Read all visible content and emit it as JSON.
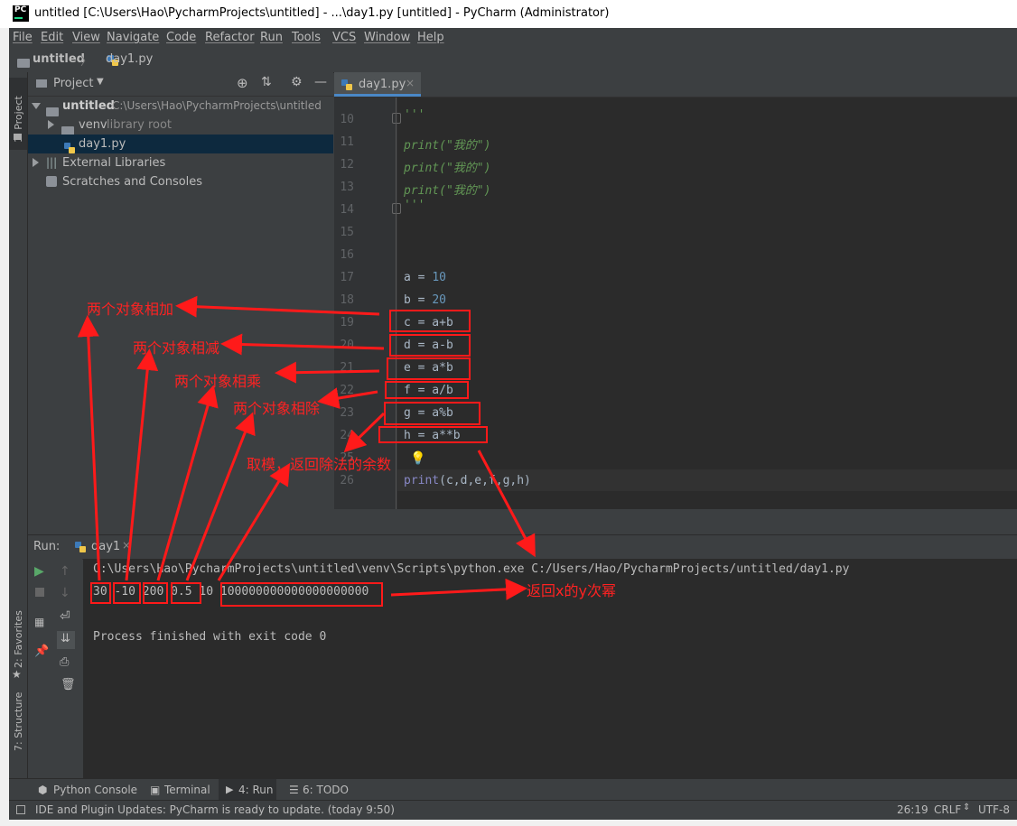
{
  "window": {
    "title": "untitled [C:\\Users\\Hao\\PycharmProjects\\untitled] - ...\\day1.py [untitled] - PyCharm (Administrator)",
    "app_icon": "PC"
  },
  "menu": [
    "File",
    "Edit",
    "View",
    "Navigate",
    "Code",
    "Refactor",
    "Run",
    "Tools",
    "VCS",
    "Window",
    "Help"
  ],
  "breadcrumb": {
    "project": "untitled",
    "file": "day1.py"
  },
  "left_stripe": {
    "project_tab": "1: Project",
    "favorites_tab": "2: Favorites",
    "structure_tab": "7: Structure"
  },
  "project_panel": {
    "header": "Project",
    "tree": [
      {
        "name": "untitled",
        "path": "C:\\Users\\Hao\\PycharmProjects\\untitled"
      },
      {
        "name": "venv",
        "hint": "library root"
      },
      {
        "name": "day1.py"
      },
      {
        "name": "External Libraries"
      },
      {
        "name": "Scratches and Consoles"
      }
    ]
  },
  "editor": {
    "tab": "day1.py",
    "line_numbers": [
      "10",
      "11",
      "12",
      "13",
      "14",
      "15",
      "16",
      "17",
      "18",
      "19",
      "20",
      "21",
      "22",
      "23",
      "24",
      "25",
      "26"
    ],
    "lines": {
      "l10": "'''",
      "l11_fn": "print",
      "l11_arg": "(\"我的\")",
      "l12_fn": "print",
      "l12_arg": "(\"我的\")",
      "l13_fn": "print",
      "l13_arg": "(\"我的\")",
      "l14": "'''",
      "l17_a": "a = ",
      "l17_b": "10",
      "l18_a": "b = ",
      "l18_b": "20",
      "l19": "c = a+b",
      "l20": "d = a-b",
      "l21": "e = a*b",
      "l22": "f = a/b",
      "l23": "g = a%b",
      "l24": "h = a**b",
      "l26_fn": "print",
      "l26_arg": "(c,d,e,f,g,h)"
    }
  },
  "run_panel": {
    "label": "Run:",
    "config": "day1",
    "command": "C:\\Users\\Hao\\PycharmProjects\\untitled\\venv\\Scripts\\python.exe C:/Users/Hao/PycharmProjects/untitled/day1.py",
    "output": [
      "30",
      "-10",
      "200",
      "0.5",
      "10",
      "100000000000000000000"
    ],
    "finished": "Process finished with exit code 0"
  },
  "tool_tabs": [
    "Python Console",
    "Terminal",
    "4: Run",
    "6: TODO"
  ],
  "status": {
    "message": "IDE and Plugin Updates: PyCharm is ready to update. (today 9:50)",
    "position": "26:19",
    "line_sep": "CRLF",
    "encoding": "UTF-8"
  },
  "annotations": {
    "add": "两个对象相加",
    "sub": "两个对象相减",
    "mul": "两个对象相乘",
    "div": "两个对象相除",
    "mod": "取模，返回除法的余数",
    "pow": "返回x的y次幂"
  },
  "colors": {
    "annotation": "#ff1a1a",
    "accent": "#4a88c7",
    "editor_bg": "#2b2b2b",
    "panel_bg": "#3c3f41"
  }
}
